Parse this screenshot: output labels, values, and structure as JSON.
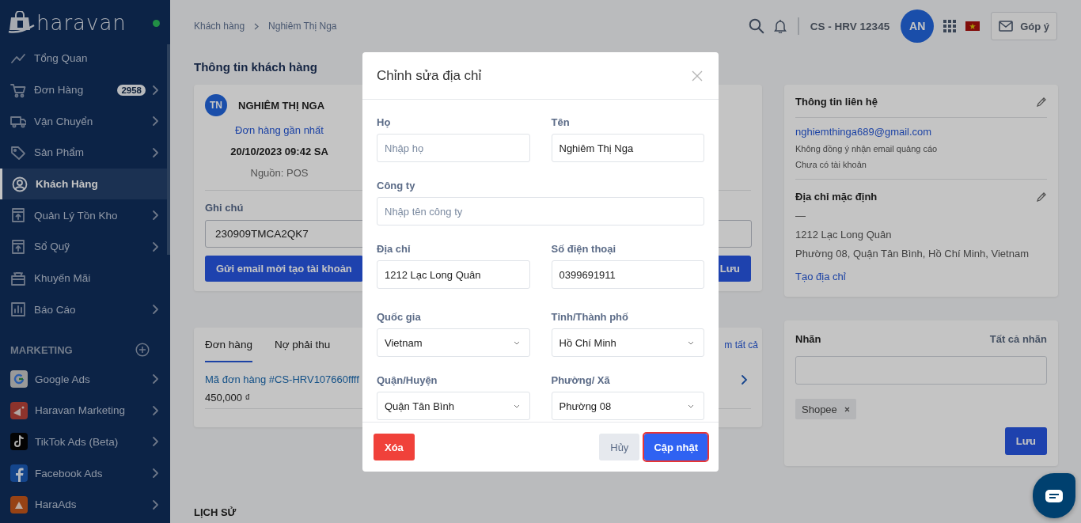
{
  "sidebar": {
    "logo": "haravan",
    "items": [
      {
        "label": "Tổng Quan",
        "expandable": false,
        "selected": false
      },
      {
        "label": "Đơn Hàng",
        "badge": "2958",
        "expandable": true,
        "selected": false
      },
      {
        "label": "Vận Chuyển",
        "expandable": true,
        "selected": false
      },
      {
        "label": "Sản Phẩm",
        "expandable": true,
        "selected": false
      },
      {
        "label": "Khách Hàng",
        "expandable": false,
        "selected": true
      },
      {
        "label": "Quản Lý Tồn Kho",
        "expandable": true,
        "selected": false
      },
      {
        "label": "Sổ Quỹ",
        "expandable": true,
        "selected": false
      },
      {
        "label": "Khuyến Mãi",
        "expandable": false,
        "selected": false
      },
      {
        "label": "Báo Cáo",
        "expandable": true,
        "selected": false
      }
    ],
    "marketing": {
      "title": "MARKETING",
      "items": [
        {
          "label": "Google Ads",
          "expandable": true
        },
        {
          "label": "Haravan Marketing",
          "expandable": true
        },
        {
          "label": "TikTok Ads (Beta)",
          "expandable": true
        },
        {
          "label": "Facebook Ads",
          "expandable": true
        },
        {
          "label": "HaraAds",
          "expandable": true
        }
      ]
    }
  },
  "header": {
    "breadcrumbs": [
      "Khách hàng",
      "Nghiêm Thị Nga"
    ],
    "account": "CS - HRV 12345",
    "avatar": "AN",
    "feedback": "Góp ý"
  },
  "page_title": "Thông tin khách hàng",
  "customer_card": {
    "initials": "TN",
    "name": "NGHIÊM THỊ NGA",
    "recent_order_label": "Đơn hàng gần nhất",
    "recent_order_date": "20/10/2023 09:42 SA",
    "source": "Nguồn: POS",
    "note_label": "Ghi chú",
    "note_value": "230909TMCA2QK7",
    "invite_button": "Gửi email mời tạo tài khoản",
    "save_button": "Lưu"
  },
  "orders_card": {
    "tabs": [
      {
        "label": "Đơn hàng",
        "selected": true
      },
      {
        "label": "Nợ phải thu",
        "selected": false
      }
    ],
    "view_all": "m tất cả",
    "orders": [
      {
        "code": "Mã đơn hàng #CS-HRV107660ffff",
        "amount": "450,000 ₫"
      }
    ]
  },
  "history_title": "LỊCH SỬ",
  "contact_card": {
    "title": "Thông tin liên hệ",
    "email": "nghiemthinga689@gmail.com",
    "notes": [
      "Không đồng ý nhận email quảng cáo",
      "Chưa có tài khoản"
    ],
    "address_title": "Địa chỉ mặc định",
    "address_lines": [
      "—",
      "1212 Lạc Long Quân",
      "Phường 08, Quận Tân Bình, Hồ Chí Minh, Vietnam"
    ],
    "create_address": "Tạo địa chỉ"
  },
  "tags_card": {
    "title": "Nhãn",
    "all_tags": "Tất cả nhãn",
    "tags": [
      "Shopee"
    ],
    "save_button": "Lưu"
  },
  "modal": {
    "title": "Chỉnh sửa địa chỉ",
    "rows": [
      [
        {
          "kind": "text",
          "label": "Họ",
          "placeholder": "Nhập họ"
        },
        {
          "kind": "text",
          "label": "Tên",
          "value": "Nghiêm Thị Nga"
        }
      ],
      [
        {
          "kind": "text",
          "label": "Công ty",
          "placeholder": "Nhập tên công ty"
        }
      ],
      [
        {
          "kind": "text",
          "label": "Địa chỉ",
          "value": "1212 Lạc Long Quân"
        },
        {
          "kind": "text",
          "label": "Số điện thoại",
          "value": "0399691911"
        }
      ],
      [
        {
          "kind": "select",
          "label": "Quốc gia",
          "value": "Vietnam"
        },
        {
          "kind": "select",
          "label": "Tỉnh/Thành phố",
          "value": "Hồ Chí Minh"
        }
      ],
      [
        {
          "kind": "select",
          "label": "Quận/Huyện",
          "value": "Quận Tân Bình"
        },
        {
          "kind": "select",
          "label": "Phường/ Xã",
          "value": "Phường 08"
        }
      ]
    ],
    "delete_button": "Xóa",
    "cancel_button": "Hủy",
    "submit_button": {
      "label": "Cập nhật",
      "focused": true
    }
  }
}
